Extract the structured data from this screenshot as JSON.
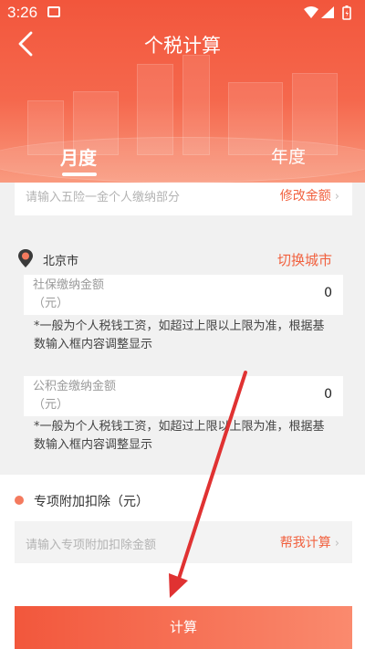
{
  "status_bar": {
    "time": "3:26"
  },
  "header": {
    "title": "个税计算"
  },
  "tabs": [
    {
      "label": "月度",
      "active": true
    },
    {
      "label": "年度",
      "active": false
    }
  ],
  "insurance": {
    "placeholder": "请输入五险一金个人缴纳部分",
    "action": "修改金额"
  },
  "city": {
    "name": "北京市",
    "action": "切换城市"
  },
  "social_security": {
    "label_line1": "社保缴纳金额",
    "label_line2": "（元）",
    "value": "0",
    "note": "*一般为个人税钱工资，如超过上限以上限为准，根据基数输入框内容调整显示"
  },
  "housing_fund": {
    "label_line1": "公积金缴纳金额",
    "label_line2": "（元）",
    "value": "0",
    "note": "*一般为个人税钱工资，如超过上限以上限为准，根据基数输入框内容调整显示"
  },
  "special_deduction": {
    "title": "专项附加扣除（元）",
    "placeholder": "请输入专项附加扣除金额",
    "action": "帮我计算"
  },
  "calc_button": {
    "label": "计算"
  },
  "colors": {
    "accent": "#f1613f",
    "header_top": "#f2563c",
    "arrow": "#e03232"
  },
  "icons": [
    "image-icon",
    "wifi-icon",
    "signal-icon",
    "battery-icon",
    "back-arrow-icon",
    "location-pin-icon",
    "chevron-right-icon"
  ]
}
